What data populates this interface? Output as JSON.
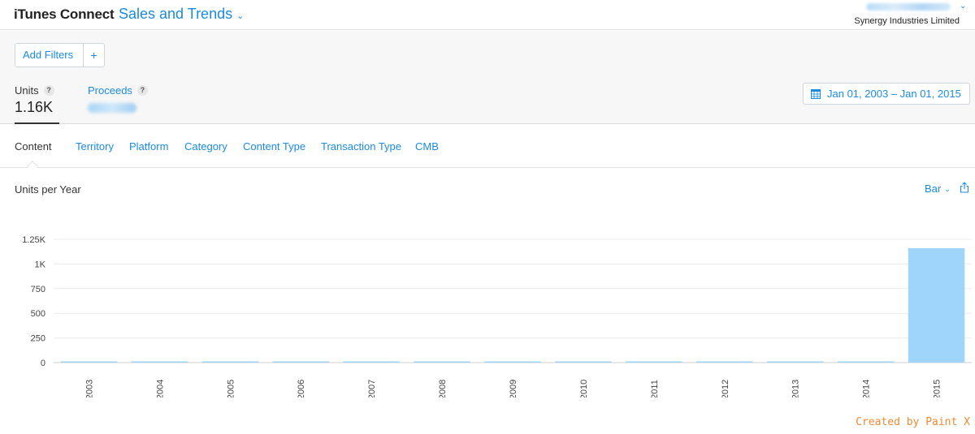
{
  "header": {
    "brand": "iTunes Connect",
    "module": "Sales and Trends",
    "organization": "Synergy Industries Limited"
  },
  "filters": {
    "add_label": "Add Filters",
    "add_plus": "+"
  },
  "metrics": {
    "units": {
      "label": "Units",
      "value": "1.16K",
      "help": "?"
    },
    "proceeds": {
      "label": "Proceeds",
      "help": "?"
    }
  },
  "date_range": "Jan 01, 2003 – Jan 01, 2015",
  "tabs": [
    {
      "label": "Content"
    },
    {
      "label": "Territory"
    },
    {
      "label": "Platform"
    },
    {
      "label": "Category"
    },
    {
      "label": "Content Type"
    },
    {
      "label": "Transaction Type"
    },
    {
      "label": "CMB"
    }
  ],
  "chart_section": {
    "title": "Units per Year",
    "chart_type_label": "Bar"
  },
  "chart_data": {
    "type": "bar",
    "categories": [
      "2003",
      "2004",
      "2005",
      "2006",
      "2007",
      "2008",
      "2009",
      "2010",
      "2011",
      "2012",
      "2013",
      "2014",
      "2015"
    ],
    "values": [
      0,
      0,
      0,
      0,
      0,
      0,
      0,
      0,
      0,
      0,
      0,
      0,
      1160
    ],
    "yticks": [
      0,
      250,
      500,
      750,
      1000,
      1250
    ],
    "ytick_labels": [
      "0",
      "250",
      "500",
      "750",
      "1K",
      "1.25K"
    ],
    "ylim": [
      0,
      1250
    ],
    "bar_color": "#9fd4fb",
    "grid": true,
    "title": "",
    "xlabel": "",
    "ylabel": ""
  },
  "footer": {
    "credit": "Created by Paint X"
  },
  "colors": {
    "link": "#1a8be0",
    "bar": "#9fd4fb",
    "credit": "#ef8a33"
  }
}
